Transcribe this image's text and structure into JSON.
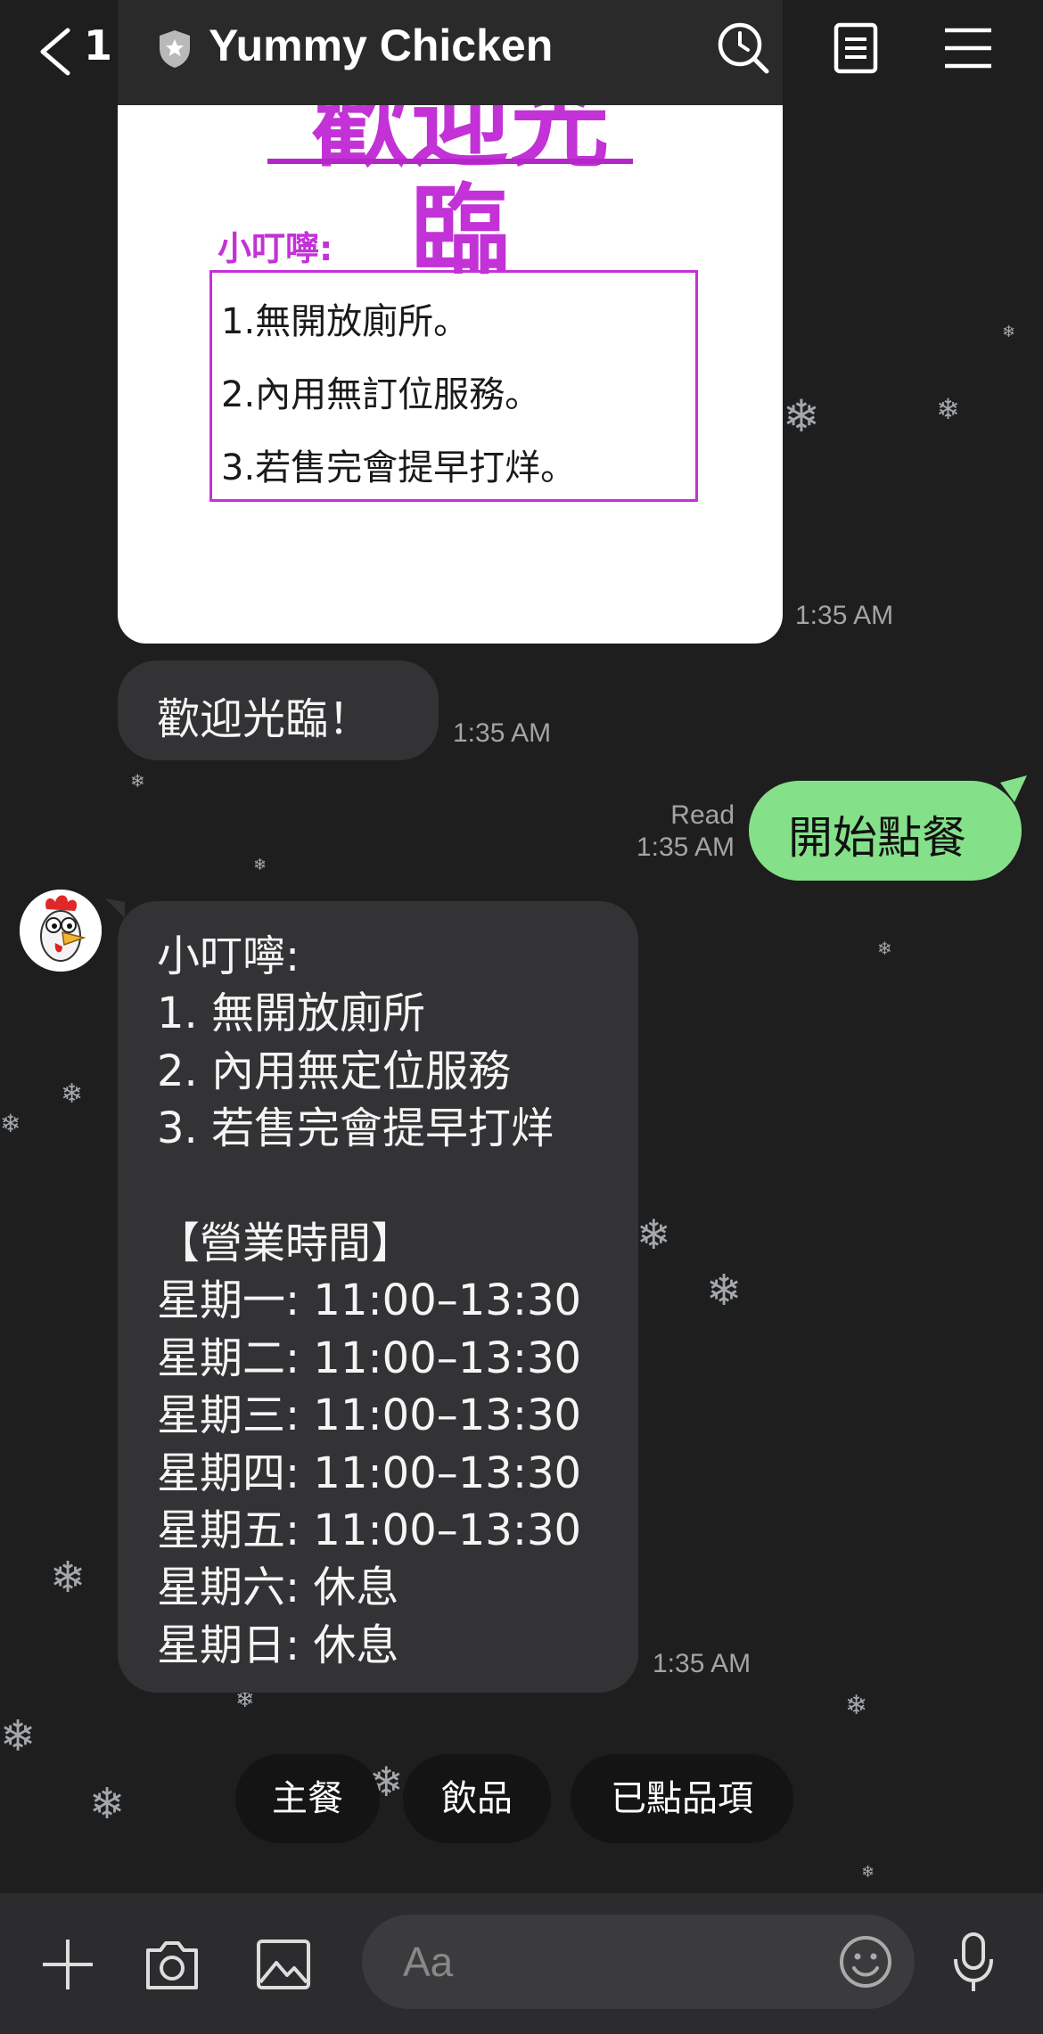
{
  "header": {
    "back_count": "1",
    "title": "Yummy Chicken"
  },
  "image_card": {
    "welcome": "歡迎光臨",
    "notice_title": "小叮嚀:",
    "notice_lines": [
      "1.無開放廁所。",
      "2.內用無訂位服務。",
      "3.若售完會提早打烊。"
    ],
    "time": "1:35 AM"
  },
  "messages": {
    "welcome_text": "歡迎光臨！",
    "welcome_time": "1:35 AM",
    "outgoing_text": "開始點餐",
    "outgoing_read": "Read",
    "outgoing_time": "1:35 AM",
    "info_text": "小叮嚀:\n1. 無開放廁所\n2. 內用無定位服務\n3. 若售完會提早打烊\n\n【營業時間】\n星期一: 11:00–13:30\n星期二: 11:00–13:30\n星期三: 11:00–13:30\n星期四: 11:00–13:30\n星期五: 11:00–13:30\n星期六: 休息\n星期日: 休息",
    "info_time": "1:35 AM"
  },
  "quick_replies": [
    "主餐",
    "飲品",
    "已點品項"
  ],
  "input": {
    "placeholder": "Aa"
  },
  "colors": {
    "background": "#1e1e1e",
    "incoming_bubble": "#333335",
    "outgoing_bubble": "#85e08a",
    "accent_magenta": "#c232d6"
  }
}
